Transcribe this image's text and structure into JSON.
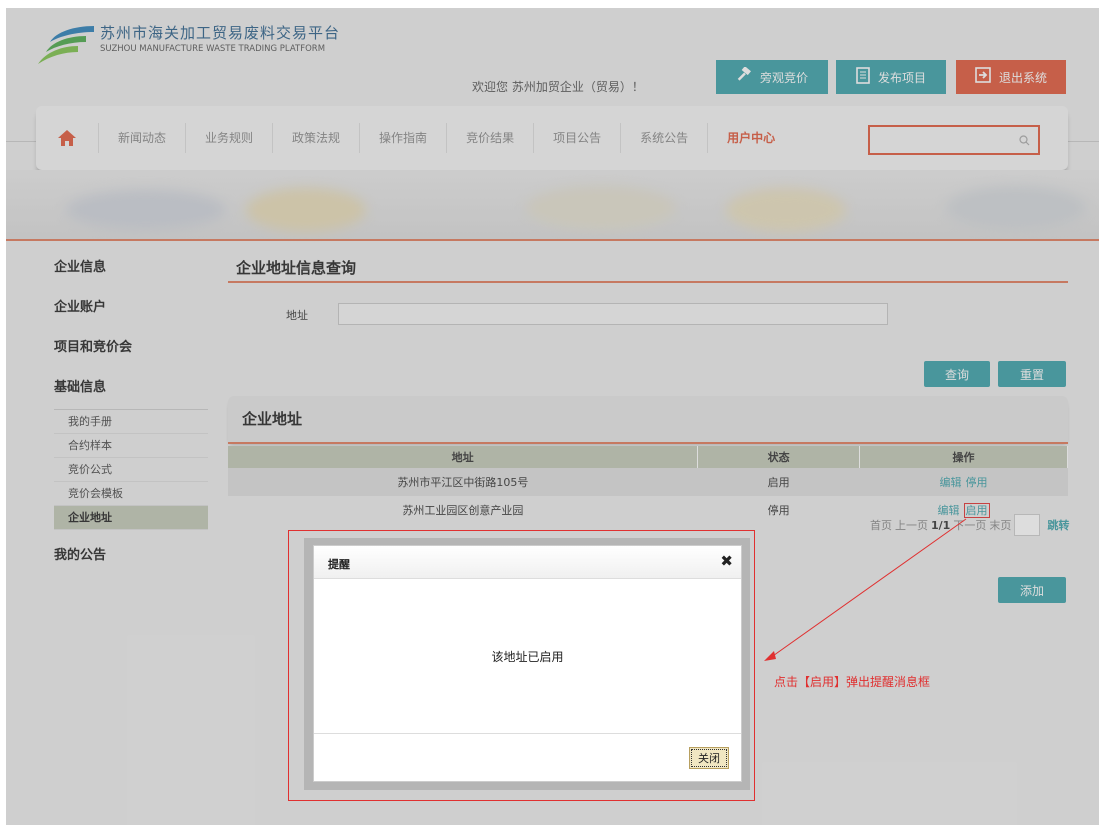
{
  "header": {
    "site_title_cn": "苏州市海关加工贸易废料交易平台",
    "site_title_en": "SUZHOU MANUFACTURE WASTE TRADING PLATFORM",
    "welcome": "欢迎您 苏州加贸企业（贸易）！",
    "buttons": {
      "watch_bid": "旁观竞价",
      "publish": "发布项目",
      "exit": "退出系统"
    }
  },
  "nav": {
    "items": [
      "新闻动态",
      "业务规则",
      "政策法规",
      "操作指南",
      "竞价结果",
      "项目公告",
      "系统公告",
      "用户中心"
    ],
    "search_placeholder": ""
  },
  "sidebar": {
    "company_info": "企业信息",
    "company_account": "企业账户",
    "project_bid": "项目和竞价会",
    "basic_info": "基础信息",
    "sub_items": [
      "我的手册",
      "合约样本",
      "竞价公式",
      "竞价会模板",
      "企业地址"
    ],
    "my_notice": "我的公告"
  },
  "query": {
    "title": "企业地址信息查询",
    "address_label": "地址",
    "address_value": "",
    "query_button": "查询",
    "reset_button": "重置"
  },
  "address_section": {
    "title": "企业地址",
    "columns": [
      "地址",
      "状态",
      "操作"
    ],
    "rows": [
      {
        "address": "苏州市平江区中街路105号",
        "status": "启用",
        "action1": "编辑",
        "action2": "停用"
      },
      {
        "address": "苏州工业园区创意产业园",
        "status": "停用",
        "action1": "编辑",
        "action2": "启用"
      }
    ],
    "pager": {
      "first": "首页",
      "prev": "上一页",
      "page": "1/1",
      "next": "下一页",
      "last": "末页",
      "go": "跳转"
    },
    "add_button": "添加"
  },
  "modal": {
    "title": "提醒",
    "message": "该地址已启用",
    "close_button": "关闭"
  },
  "annotation": "点击【启用】弹出提醒消息框",
  "colors": {
    "accent_teal": "#3aa0a8",
    "accent_orange": "#e0573a",
    "annotation_red": "#e03030"
  },
  "icons": [
    "logo-icon",
    "gavel-icon",
    "document-icon",
    "exit-icon",
    "home-icon",
    "search-icon",
    "close-icon"
  ]
}
